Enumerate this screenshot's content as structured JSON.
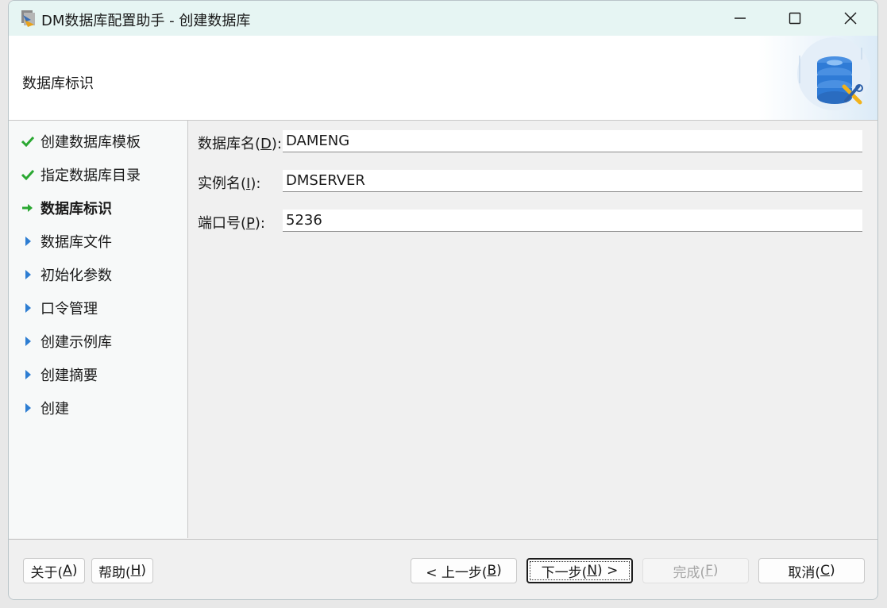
{
  "window": {
    "title": "DM数据库配置助手 - 创建数据库"
  },
  "header": {
    "title": "数据库标识"
  },
  "steps": [
    {
      "label": "创建数据库模板",
      "state": "done"
    },
    {
      "label": "指定数据库目录",
      "state": "done"
    },
    {
      "label": "数据库标识",
      "state": "current"
    },
    {
      "label": "数据库文件",
      "state": "pending"
    },
    {
      "label": "初始化参数",
      "state": "pending"
    },
    {
      "label": "口令管理",
      "state": "pending"
    },
    {
      "label": "创建示例库",
      "state": "pending"
    },
    {
      "label": "创建摘要",
      "state": "pending"
    },
    {
      "label": "创建",
      "state": "pending"
    }
  ],
  "form": {
    "db_name": {
      "label_pre": "数据库名(",
      "key": "D",
      "label_post": "):",
      "value": "DAMENG"
    },
    "instance_name": {
      "label_pre": "实例名(",
      "key": "I",
      "label_post": "):",
      "value": "DMSERVER"
    },
    "port": {
      "label_pre": "端口号(",
      "key": "P",
      "label_post": "):",
      "value": "5236"
    }
  },
  "buttons": {
    "about": {
      "pre": "关于(",
      "key": "A",
      "post": ")"
    },
    "help": {
      "pre": "帮助(",
      "key": "H",
      "post": ")"
    },
    "prev": {
      "pre": "< 上一步(",
      "key": "B",
      "post": ")"
    },
    "next": {
      "pre": "下一步(",
      "key": "N",
      "post": ") >"
    },
    "finish": {
      "pre": "完成(",
      "key": "F",
      "post": ")"
    },
    "cancel": {
      "pre": "取消(",
      "key": "C",
      "post": ")"
    }
  },
  "colors": {
    "done_check": "#2aa832",
    "current_arrow": "#2aa832",
    "pending_arrow": "#2d7dd2",
    "titlebar": "#e6f5f3"
  },
  "icons": {
    "app": "dm-app-icon",
    "header": "database-tools-icon"
  }
}
